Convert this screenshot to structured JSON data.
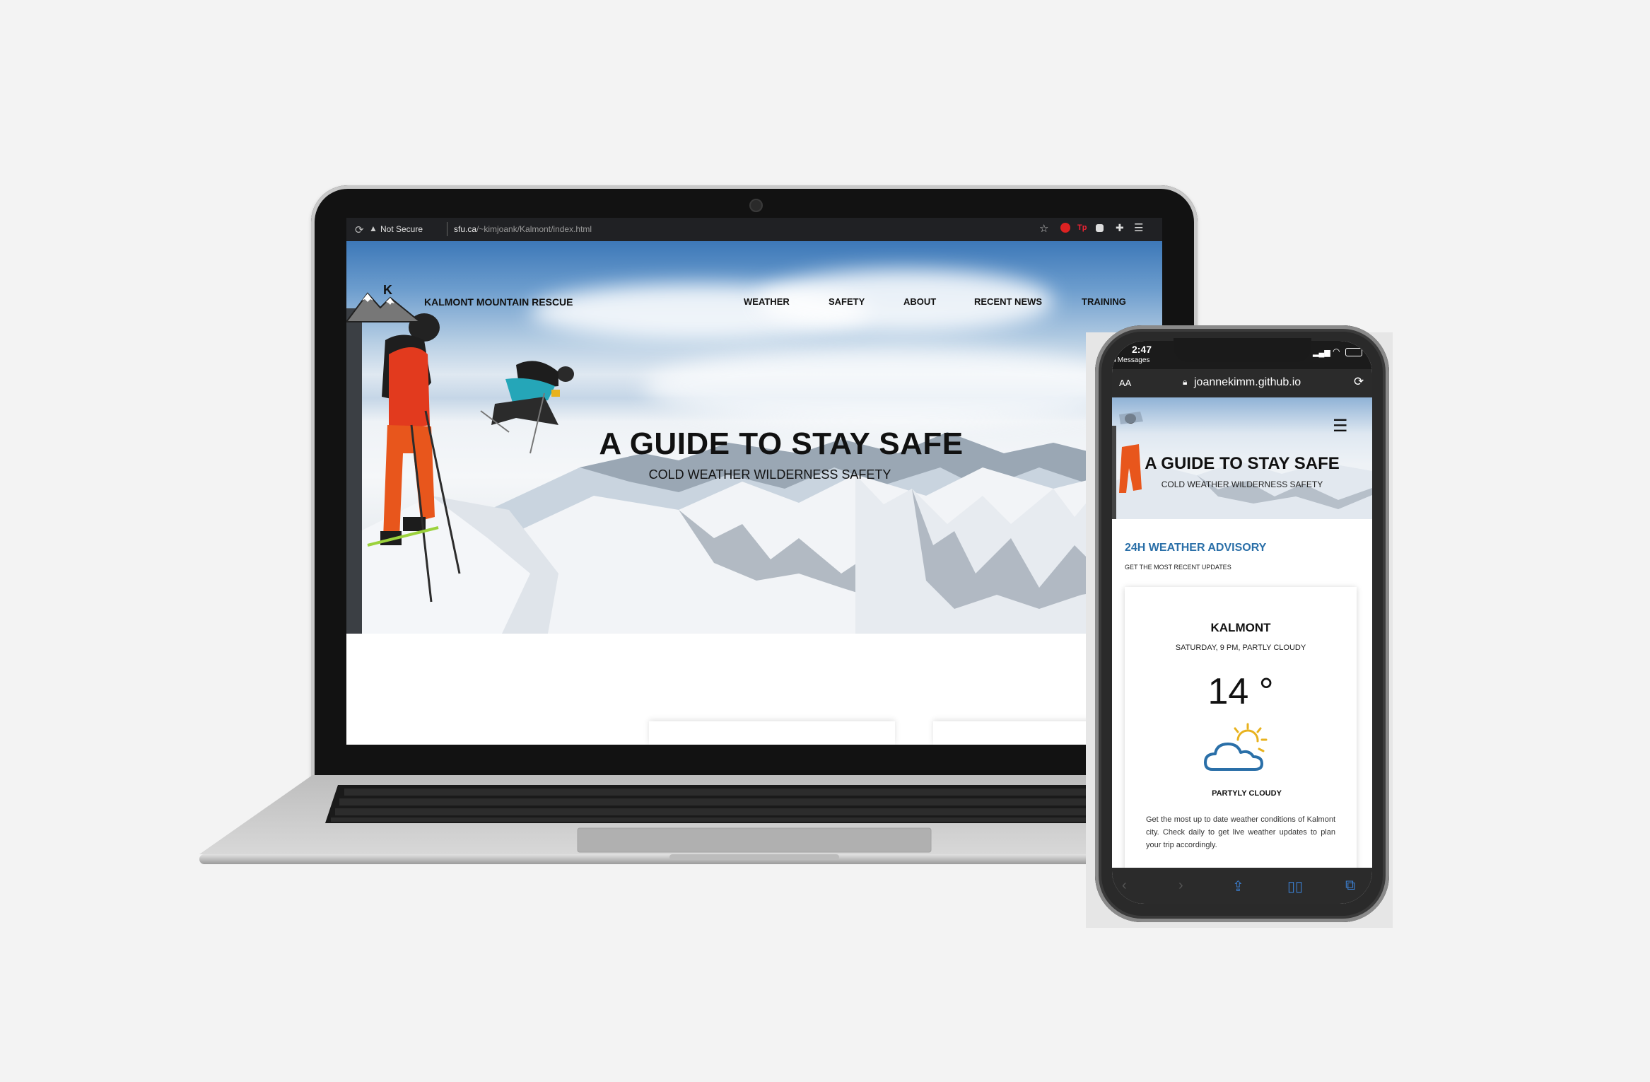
{
  "browser": {
    "security_label": "Not Secure",
    "url_domain": "sfu.ca",
    "url_path": "/~kimjoank/Kalmont/index.html"
  },
  "site": {
    "brand": "KALMONT MOUNTAIN RESCUE",
    "logo_letter": "K",
    "nav": [
      "WEATHER",
      "SAFETY",
      "ABOUT",
      "RECENT NEWS",
      "TRAINING"
    ],
    "hero_title": "A GUIDE TO STAY SAFE",
    "hero_subtitle": "COLD WEATHER WILDERNESS SAFETY"
  },
  "phone": {
    "time": "2:47",
    "back_app": "◂ Messages",
    "text_size_label": "AA",
    "url": "joannekimm.github.io",
    "hero_title": "A GUIDE TO STAY SAFE",
    "hero_subtitle": "COLD WEATHER WILDERNESS SAFETY",
    "advisory_title": "24H WEATHER ADVISORY",
    "advisory_subtitle": "GET THE MOST RECENT UPDATES",
    "weather": {
      "city": "KALMONT",
      "when": "SATURDAY, 9 PM, PARTLY CLOUDY",
      "temperature": "14 °",
      "condition": "PARTYLY CLOUDY",
      "description": "Get the most up to date weather conditions of Kalmont city. Check daily to get live weather updates to plan your trip accordingly."
    }
  },
  "colors": {
    "accent_blue": "#2a6fa8",
    "sun_yellow": "#e8b21e",
    "page_bg": "#f3f3f3"
  },
  "icons": [
    "reload-icon",
    "warning-icon",
    "star-icon",
    "extension-icon",
    "menu-icon",
    "lock-icon",
    "share-icon",
    "bookmarks-icon",
    "tabs-icon",
    "partly-cloudy-icon"
  ]
}
